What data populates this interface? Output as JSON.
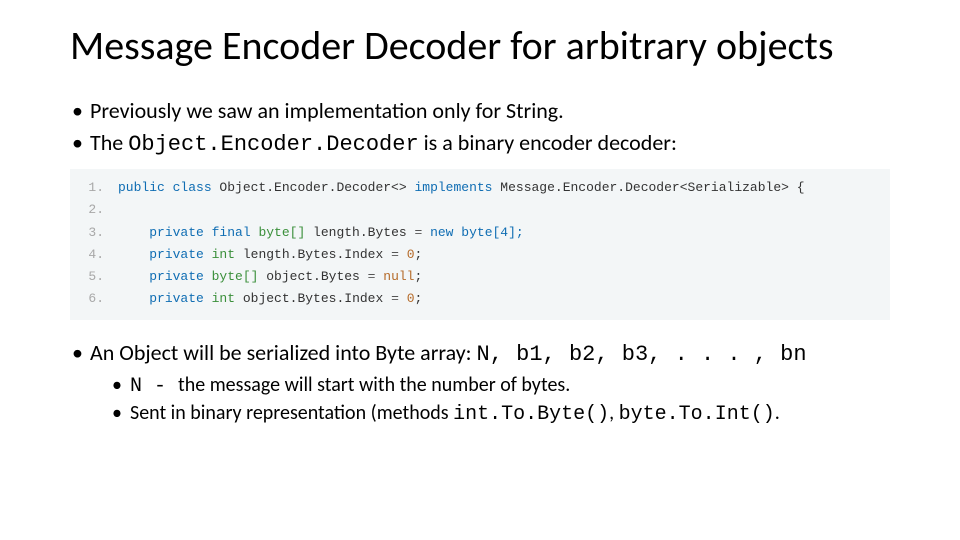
{
  "title": "Message Encoder Decoder for arbitrary objects",
  "bullets": {
    "b1": "Previously we saw an implementation only for String.",
    "b2_pre": "The ",
    "b2_code": "Object.Encoder.Decoder",
    "b2_post": " is a binary encoder decoder:",
    "b3_pre": "An Object will be serialized into Byte array: ",
    "b3_code": "N, b1, b2, b3, . . . , bn",
    "b3_s1_code": "N - ",
    "b3_s1_post": " the message will start with the number of bytes.",
    "b3_s2_pre": "Sent in binary representation (methods ",
    "b3_s2_c1": "int.To.Byte()",
    "b3_s2_mid": ", ",
    "b3_s2_c2": "byte.To.Int()",
    "b3_s2_post": "."
  },
  "code": {
    "l1": {
      "n": "1.",
      "kw1": "public class",
      "t1": " Object.Encoder.Decoder<> ",
      "kw2": "implements",
      "t2": " Message.Encoder.Decoder<Serializable> {"
    },
    "l2": {
      "n": "2."
    },
    "l3": {
      "n": "3.",
      "kw": "private final",
      "typ": " byte[]",
      "name": " length.Bytes ",
      "op": "=",
      "rest": " new byte[4];"
    },
    "l4": {
      "n": "4.",
      "kw": "private",
      "typ": " int",
      "name": " length.Bytes.Index ",
      "op": "=",
      "lit": " 0",
      "semi": ";"
    },
    "l5": {
      "n": "5.",
      "kw": "private",
      "typ": " byte[]",
      "name": " object.Bytes ",
      "op": "=",
      "lit": " null",
      "semi": ";"
    },
    "l6": {
      "n": "6.",
      "kw": "private",
      "typ": " int",
      "name": " object.Bytes.Index ",
      "op": "=",
      "lit": " 0",
      "semi": ";"
    }
  }
}
